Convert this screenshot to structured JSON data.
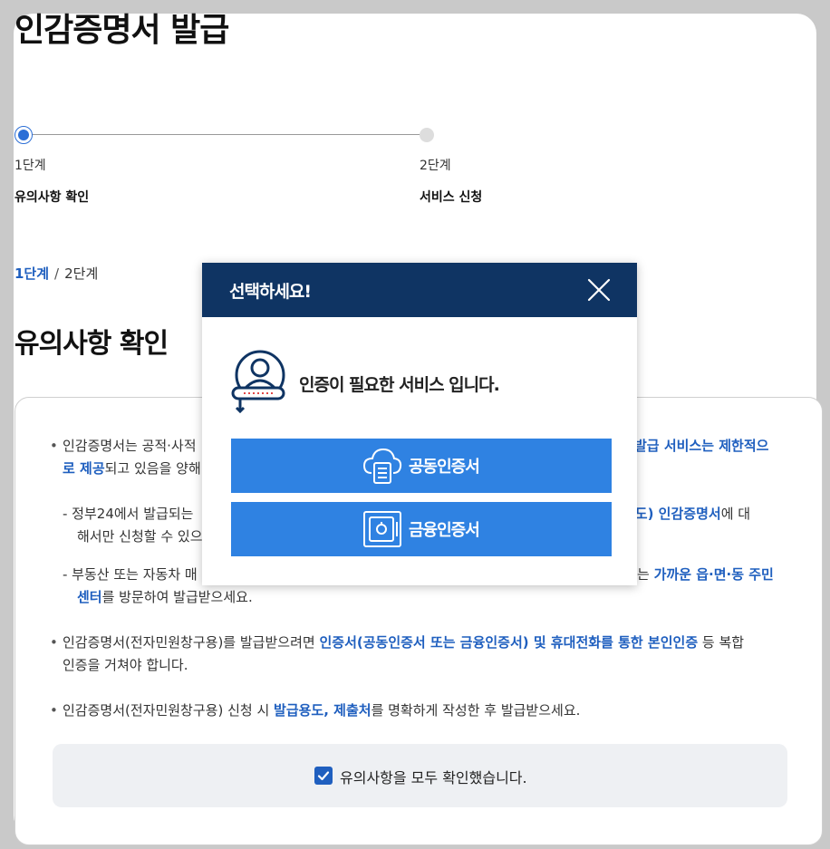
{
  "page": {
    "title": "인감증명서 발급"
  },
  "stepper": {
    "steps": [
      {
        "num": "1단계",
        "label": "유의사항 확인"
      },
      {
        "num": "2단계",
        "label": "서비스 신청"
      }
    ]
  },
  "breadcrumb": {
    "current": "1단계",
    "separator": "/",
    "next": "2단계"
  },
  "section": {
    "title": "유의사항 확인"
  },
  "notices": {
    "n1_a": "인감증명서는 공적·사적",
    "n1_b_blue": "발급 서비스는 제한적으",
    "n1_c_blue": "로 제공",
    "n1_d": "되고 있음을 양해",
    "n2_a": "- 정부24에서 발급되는",
    "n2_b_blue": "용도) 인감증명서",
    "n2_c": "에 대",
    "n2_d": "해서만 신청할 수 있으",
    "n3_a": "- 부동산 또는 자동차 매",
    "n3_b": "는",
    "n3_c_blue": "가까운 읍·면·동 주민",
    "n3_d_blue": "센터",
    "n3_e": "를 방문하여 발급받으세요.",
    "n4_a": "인감증명서(전자민원창구용)를 발급받으려면",
    "n4_b_blue": "인증서(공동인증서 또는 금융인증서) 및 휴대전화를 통한 본인인증",
    "n4_c": "등 복합",
    "n4_d": "인증을 거쳐야 합니다.",
    "n5_a": "인감증명서(전자민원창구용) 신청 시",
    "n5_b_blue": "발급용도, 제출처",
    "n5_c": "를 명확하게 작성한 후 발급받으세요."
  },
  "confirm": {
    "label": "유의사항을 모두 확인했습니다.",
    "checked": true
  },
  "modal": {
    "title": "선택하세요!",
    "message": "인증이 필요한 서비스 입니다.",
    "buttons": [
      {
        "label": "공동인증서",
        "icon": "cloud-certificate-icon"
      },
      {
        "label": "금융인증서",
        "icon": "safe-certificate-icon"
      }
    ]
  },
  "colors": {
    "accent": "#2f82e2",
    "header": "#0f3463",
    "link": "#1f5fbf"
  }
}
